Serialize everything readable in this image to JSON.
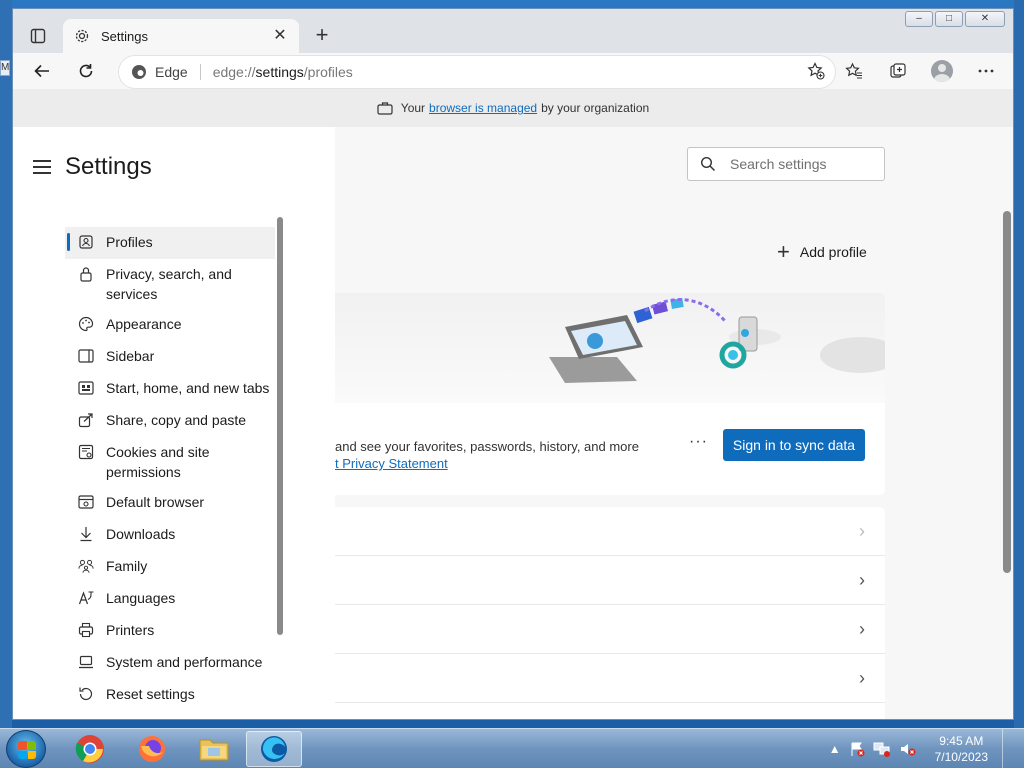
{
  "desktop": {
    "stub_text": "M"
  },
  "browser": {
    "tab": {
      "title": "Settings"
    },
    "new_tab_label": "+",
    "window_controls": {
      "minimize": "–",
      "maximize": "□",
      "close": "✕"
    },
    "address": {
      "site_name": "Edge",
      "url_prefix": "edge://",
      "url_bold": "settings",
      "url_suffix": "/profiles"
    }
  },
  "managed_bar": {
    "prefix": "Your",
    "link": "browser is managed",
    "suffix": "by your organization"
  },
  "sidebar": {
    "title": "Settings",
    "items": [
      {
        "label": "Profiles",
        "icon": "profile-icon",
        "active": true
      },
      {
        "label": "Privacy, search, and services",
        "icon": "lock-icon"
      },
      {
        "label": "Appearance",
        "icon": "palette-icon"
      },
      {
        "label": "Sidebar",
        "icon": "sidebar-icon"
      },
      {
        "label": "Start, home, and new tabs",
        "icon": "home-icon"
      },
      {
        "label": "Share, copy and paste",
        "icon": "share-icon"
      },
      {
        "label": "Cookies and site permissions",
        "icon": "cookie-icon"
      },
      {
        "label": "Default browser",
        "icon": "browser-icon"
      },
      {
        "label": "Downloads",
        "icon": "download-icon"
      },
      {
        "label": "Family",
        "icon": "family-icon"
      },
      {
        "label": "Languages",
        "icon": "language-icon"
      },
      {
        "label": "Printers",
        "icon": "printer-icon"
      },
      {
        "label": "System and performance",
        "icon": "laptop-icon"
      },
      {
        "label": "Reset settings",
        "icon": "reset-icon"
      }
    ]
  },
  "search": {
    "placeholder": "Search settings"
  },
  "profile": {
    "add_profile_label": "Add profile",
    "card_text": "and see your favorites, passwords, history, and more",
    "card_link": "t Privacy Statement",
    "more_label": "···",
    "sync_button_label": "Sign in to sync data",
    "row_chevron": "›"
  },
  "taskbar": {
    "apps": [
      "chrome",
      "firefox",
      "file-explorer",
      "edge"
    ],
    "clock_time": "9:45 AM",
    "clock_date": "7/10/2023"
  },
  "colors": {
    "accent": "#0f6cbd",
    "taskbar": "#6f95bf",
    "desktop": "#1e63ad"
  }
}
